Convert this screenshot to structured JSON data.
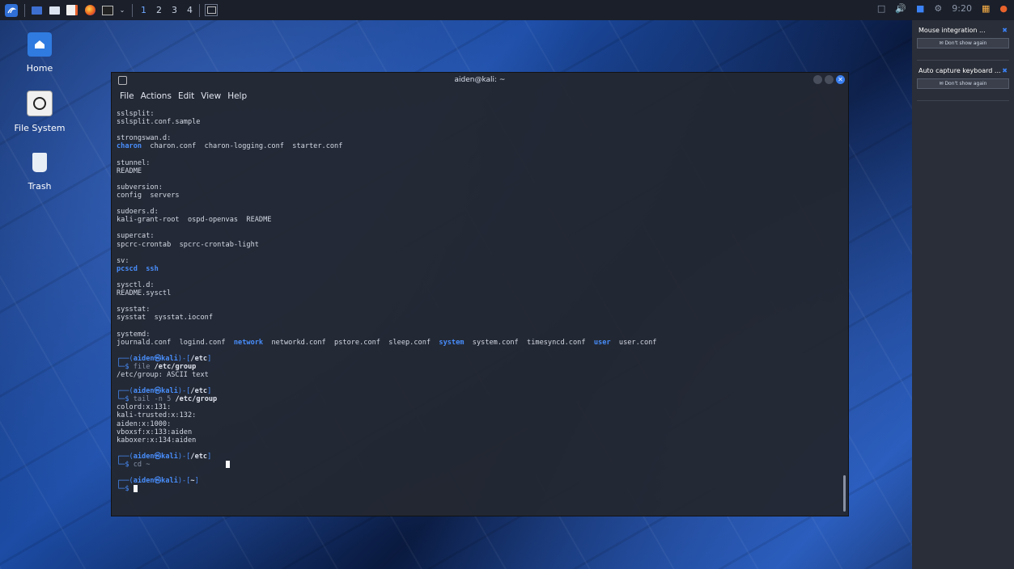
{
  "taskbar": {
    "workspaces": [
      "1",
      "2",
      "3",
      "4"
    ],
    "clock": "9:20"
  },
  "desktop": {
    "icons": [
      {
        "label": "Home"
      },
      {
        "label": "File System"
      },
      {
        "label": "Trash"
      }
    ]
  },
  "terminal": {
    "title": "aiden@kali: ~",
    "menu": [
      "File",
      "Actions",
      "Edit",
      "View",
      "Help"
    ]
  },
  "notifications": [
    {
      "title": "Mouse integration ...",
      "button": "Don't show again"
    },
    {
      "title": "Auto capture keyboard ...",
      "button": "Don't show again"
    }
  ]
}
